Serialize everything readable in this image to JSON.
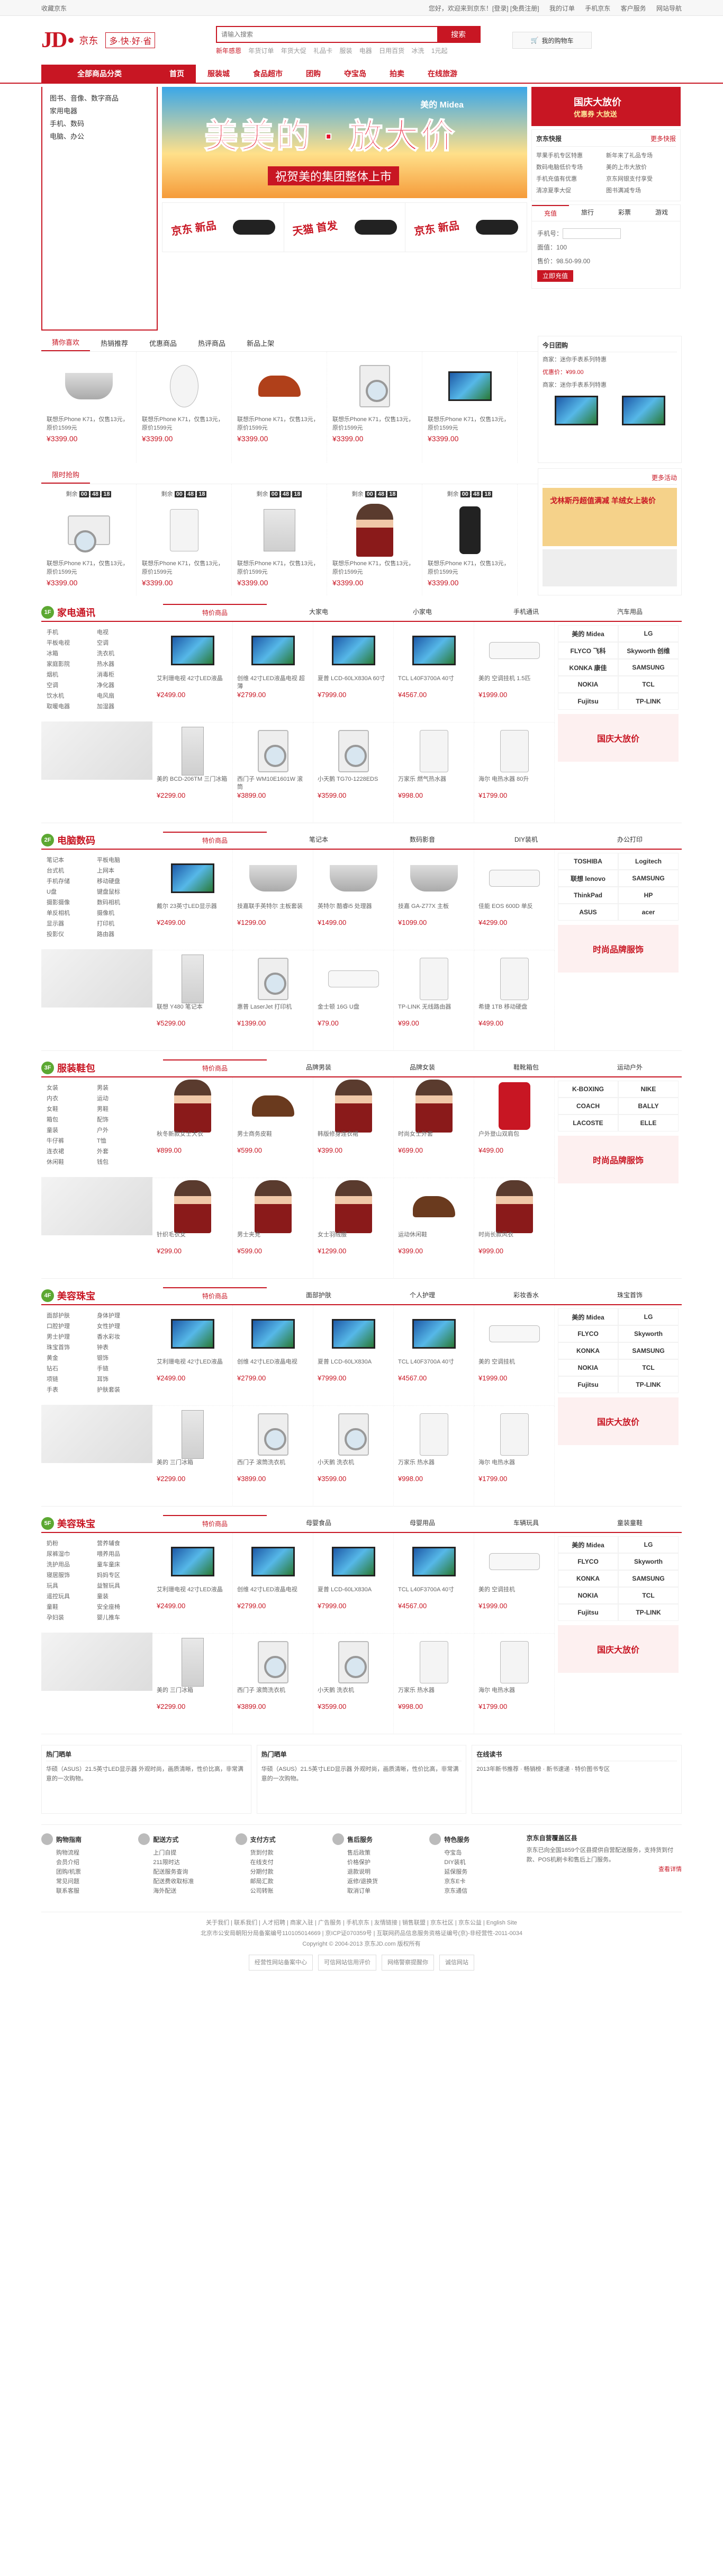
{
  "topbar": {
    "fav": "收藏京东",
    "links": [
      "您好，欢迎来到京东！[登录] [免费注册]",
      "我的订单",
      "手机京东",
      "客户服务",
      "网站导航"
    ]
  },
  "header": {
    "logo_jd": "JD",
    "logo_com": "京东",
    "logo_dotcom": "COM",
    "slogan": "多·快·好·省",
    "search_placeholder": "请输入搜索",
    "search_btn": "搜索",
    "hot": [
      "新年感恩",
      "年货订单",
      "年货大促",
      "礼品卡",
      "服装",
      "电器",
      "日用百货",
      "冰洗",
      "1元起"
    ],
    "cart": "我的购物车"
  },
  "nav": {
    "allcat": "全部商品分类",
    "items": [
      "首页",
      "服装城",
      "食品超市",
      "团购",
      "夺宝岛",
      "拍卖",
      "在线旅游"
    ]
  },
  "catmenu": [
    "图书、音像、数字商品",
    "家用电器",
    "手机、数码",
    "电脑、办公"
  ],
  "banner": {
    "title": "美美的 · 放大价",
    "subtitle": "祝贺美的集团整体上市",
    "brand": "美的 Midea"
  },
  "promo3": [
    "京东 新品",
    "天猫 首发",
    "京东 新品"
  ],
  "rightcol": {
    "banner_title": "国庆大放价",
    "banner_sub": "优惠券 大放送",
    "news_title": "京东快报",
    "news_more": "更多快报",
    "news": [
      "苹果手机专区特惠",
      "新年来了礼品专场",
      "数码电脑低价专场",
      "美的上市大放价",
      "手机充值有优惠",
      "京东网银支付享受",
      "清凉夏季大促",
      "图书满减专场"
    ],
    "tabs": [
      "充值",
      "旅行",
      "彩票",
      "游戏"
    ],
    "recharge_label": "手机号：",
    "recharge_amount": "面值：100",
    "recharge_price": "售价：98.50-99.00",
    "recharge_btn": "立即充值"
  },
  "row1": {
    "tabs": [
      "猜你喜欢",
      "热销推荐",
      "优惠商品",
      "热评商品",
      "新品上架"
    ],
    "products": [
      {
        "name": "联想乐Phone K71，仅售13元，原价1599元",
        "price": "¥3399.00"
      },
      {
        "name": "联想乐Phone K71，仅售13元，原价1599元",
        "price": "¥3399.00"
      },
      {
        "name": "联想乐Phone K71，仅售13元，原价1599元",
        "price": "¥3399.00"
      },
      {
        "name": "联想乐Phone K71，仅售13元，原价1599元",
        "price": "¥3399.00"
      },
      {
        "name": "联想乐Phone K71，仅售13元，原价1599元",
        "price": "¥3399.00"
      }
    ],
    "side_title": "今日团购",
    "side_lines": [
      "商家：迷你手表系列特惠",
      "优惠价：¥99.00",
      "商家：迷你手表系列特惠"
    ]
  },
  "row2": {
    "title": "限时抢购",
    "timer_label": "剩余",
    "timer": [
      "00",
      "48",
      "18"
    ],
    "products": [
      {
        "name": "联想乐Phone K71，仅售13元，原价1599元",
        "price": "¥3399.00"
      },
      {
        "name": "联想乐Phone K71，仅售13元，原价1599元",
        "price": "¥3399.00"
      },
      {
        "name": "联想乐Phone K71，仅售13元，原价1599元",
        "price": "¥3399.00"
      },
      {
        "name": "联想乐Phone K71，仅售13元，原价1599元",
        "price": "¥3399.00"
      },
      {
        "name": "联想乐Phone K71，仅售13元，原价1599元",
        "price": "¥3399.00"
      }
    ],
    "side_more": "更多活动",
    "side_ad": "戈林斯丹超值满减 羊绒女上装价"
  },
  "floors": [
    {
      "num": "1F",
      "title": "家电通讯",
      "tabs": [
        "特价商品",
        "大家电",
        "小家电",
        "手机通讯",
        "汽车用品"
      ],
      "cats": [
        "手机",
        "电视",
        "平板电视",
        "空调",
        "冰箱",
        "洗衣机",
        "家庭影院",
        "热水器",
        "烟机",
        "消毒柜",
        "空调",
        "净化器",
        "饮水机",
        "电风扇",
        "取暖电器",
        "加湿器"
      ],
      "items": [
        {
          "kind": "tv",
          "name": "艾利珊电视 42寸LED液晶",
          "price": "¥2499.00"
        },
        {
          "kind": "tv",
          "name": "创维 42寸LED液晶电视 超薄",
          "price": "¥2799.00"
        },
        {
          "kind": "tv",
          "name": "夏普 LCD-60LX830A 60寸",
          "price": "¥7999.00"
        },
        {
          "kind": "tv",
          "name": "TCL L40F3700A 40寸",
          "price": "¥4567.00"
        },
        {
          "kind": "ac",
          "name": "美的 空调挂机 1.5匹",
          "price": "¥1999.00"
        },
        {
          "kind": "fridge",
          "name": "美的 BCD-206TM 三门冰箱",
          "price": "¥2299.00"
        },
        {
          "kind": "wash",
          "name": "西门子 WM10E1601W 滚筒",
          "price": "¥3899.00"
        },
        {
          "kind": "wash",
          "name": "小天鹅 TG70-1228EDS",
          "price": "¥3599.00"
        },
        {
          "kind": "heater",
          "name": "万家乐 燃气热水器",
          "price": "¥998.00"
        },
        {
          "kind": "heater",
          "name": "海尔 电热水器 80升",
          "price": "¥1799.00"
        }
      ],
      "brands": [
        "美的 Midea",
        "LG",
        "FLYCO 飞科",
        "Skyworth 创维",
        "KONKA 康佳",
        "SAMSUNG",
        "NOKIA",
        "TCL",
        "Fujitsu",
        "TP-LINK"
      ],
      "ad": "国庆大放价"
    },
    {
      "num": "2F",
      "title": "电脑数码",
      "tabs": [
        "特价商品",
        "笔记本",
        "数码影音",
        "DIY装机",
        "办公打印"
      ],
      "cats": [
        "笔记本",
        "平板电脑",
        "台式机",
        "上网本",
        "手机存储",
        "移动硬盘",
        "U盘",
        "键盘鼠标",
        "摄影摄像",
        "数码相机",
        "单反相机",
        "摄像机",
        "显示器",
        "打印机",
        "投影仪",
        "路由器"
      ],
      "items": [
        {
          "kind": "tv",
          "name": "戴尔 23英寸LED显示器",
          "price": "¥2499.00"
        },
        {
          "kind": "pot",
          "name": "技嘉联手英特尔 主板套装",
          "price": "¥1299.00"
        },
        {
          "kind": "pot",
          "name": "英特尔 酷睿i5 处理器",
          "price": "¥1499.00"
        },
        {
          "kind": "pot",
          "name": "技嘉 GA-Z77X 主板",
          "price": "¥1099.00"
        },
        {
          "kind": "ac",
          "name": "佳能 EOS 600D 单反",
          "price": "¥4299.00"
        },
        {
          "kind": "fridge",
          "name": "联想 Y480 笔记本",
          "price": "¥5299.00"
        },
        {
          "kind": "wash",
          "name": "惠普 LaserJet 打印机",
          "price": "¥1399.00"
        },
        {
          "kind": "ac",
          "name": "金士顿 16G U盘",
          "price": "¥79.00"
        },
        {
          "kind": "heater",
          "name": "TP-LINK 无线路由器",
          "price": "¥99.00"
        },
        {
          "kind": "heater",
          "name": "希捷 1TB 移动硬盘",
          "price": "¥499.00"
        }
      ],
      "brands": [
        "TOSHIBA",
        "Logitech",
        "联想 lenovo",
        "SAMSUNG",
        "ThinkPad",
        "HP",
        "ASUS",
        "acer"
      ],
      "ad": "时尚品牌服饰"
    },
    {
      "num": "3F",
      "title": "服装鞋包",
      "tabs": [
        "特价商品",
        "品牌男装",
        "品牌女装",
        "鞋靴箱包",
        "运动户外"
      ],
      "cats": [
        "女装",
        "男装",
        "内衣",
        "运动",
        "女鞋",
        "男鞋",
        "箱包",
        "配饰",
        "童装",
        "户外",
        "牛仔裤",
        "T恤",
        "连衣裙",
        "外套",
        "休闲鞋",
        "钱包"
      ],
      "items": [
        {
          "kind": "person",
          "name": "秋冬新款女士大衣",
          "price": "¥899.00"
        },
        {
          "kind": "shoe",
          "name": "男士商务皮鞋",
          "price": "¥599.00"
        },
        {
          "kind": "person",
          "name": "韩版修身连衣裙",
          "price": "¥399.00"
        },
        {
          "kind": "person",
          "name": "时尚女士外套",
          "price": "¥699.00"
        },
        {
          "kind": "bag",
          "name": "户外登山双肩包",
          "price": "¥499.00"
        },
        {
          "kind": "person",
          "name": "针织毛衣女",
          "price": "¥299.00"
        },
        {
          "kind": "person",
          "name": "男士夹克",
          "price": "¥599.00"
        },
        {
          "kind": "person",
          "name": "女士羽绒服",
          "price": "¥1299.00"
        },
        {
          "kind": "shoe",
          "name": "运动休闲鞋",
          "price": "¥399.00"
        },
        {
          "kind": "person",
          "name": "时尚长款风衣",
          "price": "¥999.00"
        }
      ],
      "brands": [
        "K-BOXING",
        "NIKE",
        "COACH",
        "BALLY",
        "LACOSTE",
        "ELLE"
      ],
      "ad": "时尚品牌服饰"
    },
    {
      "num": "4F",
      "title": "美容珠宝",
      "tabs": [
        "特价商品",
        "面部护肤",
        "个人护理",
        "彩妆香水",
        "珠宝首饰"
      ],
      "cats": [
        "面部护肤",
        "身体护理",
        "口腔护理",
        "女性护理",
        "男士护理",
        "香水彩妆",
        "珠宝首饰",
        "钟表",
        "黄金",
        "银饰",
        "钻石",
        "手链",
        "项链",
        "耳饰",
        "手表",
        "护肤套装"
      ],
      "items": [
        {
          "kind": "tv",
          "name": "艾利珊电视 42寸LED液晶",
          "price": "¥2499.00"
        },
        {
          "kind": "tv",
          "name": "创维 42寸LED液晶电视",
          "price": "¥2799.00"
        },
        {
          "kind": "tv",
          "name": "夏普 LCD-60LX830A",
          "price": "¥7999.00"
        },
        {
          "kind": "tv",
          "name": "TCL L40F3700A 40寸",
          "price": "¥4567.00"
        },
        {
          "kind": "ac",
          "name": "美的 空调挂机",
          "price": "¥1999.00"
        },
        {
          "kind": "fridge",
          "name": "美的 三门冰箱",
          "price": "¥2299.00"
        },
        {
          "kind": "wash",
          "name": "西门子 滚筒洗衣机",
          "price": "¥3899.00"
        },
        {
          "kind": "wash",
          "name": "小天鹅 洗衣机",
          "price": "¥3599.00"
        },
        {
          "kind": "heater",
          "name": "万家乐 热水器",
          "price": "¥998.00"
        },
        {
          "kind": "heater",
          "name": "海尔 电热水器",
          "price": "¥1799.00"
        }
      ],
      "brands": [
        "美的 Midea",
        "LG",
        "FLYCO",
        "Skyworth",
        "KONKA",
        "SAMSUNG",
        "NOKIA",
        "TCL",
        "Fujitsu",
        "TP-LINK"
      ],
      "ad": "国庆大放价"
    },
    {
      "num": "5F",
      "title": "美容珠宝",
      "tabs": [
        "特价商品",
        "母婴食品",
        "母婴用品",
        "车辆玩具",
        "童装童鞋"
      ],
      "cats": [
        "奶粉",
        "营养辅食",
        "尿裤湿巾",
        "喂养用品",
        "洗护用品",
        "童车童床",
        "寝居服饰",
        "妈妈专区",
        "玩具",
        "益智玩具",
        "遥控玩具",
        "童装",
        "童鞋",
        "安全座椅",
        "孕妇装",
        "婴儿推车"
      ],
      "items": [
        {
          "kind": "tv",
          "name": "艾利珊电视 42寸LED液晶",
          "price": "¥2499.00"
        },
        {
          "kind": "tv",
          "name": "创维 42寸LED液晶电视",
          "price": "¥2799.00"
        },
        {
          "kind": "tv",
          "name": "夏普 LCD-60LX830A",
          "price": "¥7999.00"
        },
        {
          "kind": "tv",
          "name": "TCL L40F3700A 40寸",
          "price": "¥4567.00"
        },
        {
          "kind": "ac",
          "name": "美的 空调挂机",
          "price": "¥1999.00"
        },
        {
          "kind": "fridge",
          "name": "美的 三门冰箱",
          "price": "¥2299.00"
        },
        {
          "kind": "wash",
          "name": "西门子 滚筒洗衣机",
          "price": "¥3899.00"
        },
        {
          "kind": "wash",
          "name": "小天鹅 洗衣机",
          "price": "¥3599.00"
        },
        {
          "kind": "heater",
          "name": "万家乐 热水器",
          "price": "¥998.00"
        },
        {
          "kind": "heater",
          "name": "海尔 电热水器",
          "price": "¥1799.00"
        }
      ],
      "brands": [
        "美的 Midea",
        "LG",
        "FLYCO",
        "Skyworth",
        "KONKA",
        "SAMSUNG",
        "NOKIA",
        "TCL",
        "Fujitsu",
        "TP-LINK"
      ],
      "ad": "国庆大放价"
    }
  ],
  "bottom": {
    "panels": [
      {
        "title": "热门晒单",
        "text": "华硕（ASUS）21.5英寸LED显示器 外观时尚，画质清晰，性价比高，非常满意的一次购物。"
      },
      {
        "title": "热门晒单",
        "text": "华硕（ASUS）21.5英寸LED显示器 外观时尚，画质清晰，性价比高，非常满意的一次购物。"
      },
      {
        "title": "在线读书",
        "text": "2013年新书推荐 · 畅销榜 · 新书速递 · 特价图书专区"
      }
    ]
  },
  "help": [
    {
      "title": "购物指南",
      "lines": [
        "购物流程",
        "会员介绍",
        "团购/机票",
        "常见问题",
        "联系客服"
      ]
    },
    {
      "title": "配送方式",
      "lines": [
        "上门自提",
        "211限时达",
        "配送服务查询",
        "配送费收取标准",
        "海外配送"
      ]
    },
    {
      "title": "支付方式",
      "lines": [
        "货到付款",
        "在线支付",
        "分期付款",
        "邮局汇款",
        "公司转账"
      ]
    },
    {
      "title": "售后服务",
      "lines": [
        "售后政策",
        "价格保护",
        "退款说明",
        "返修/退换货",
        "取消订单"
      ]
    },
    {
      "title": "特色服务",
      "lines": [
        "夺宝岛",
        "DIY装机",
        "延保服务",
        "京东E卡",
        "京东通信"
      ]
    },
    {
      "title": "京东自营覆盖区县",
      "lines": [
        "京东已向全国1859个区县提供自营配送服务，支持货到付款、POS机刷卡和售后上门服务。",
        "查看详情"
      ]
    }
  ],
  "footer": {
    "links": "关于我们 | 联系我们 | 人才招聘 | 商家入驻 | 广告服务 | 手机京东 | 友情链接 | 销售联盟 | 京东社区 | 京东公益 | English Site",
    "copy1": "北京市公安局朝阳分局备案编号110105014669 | 京ICP证070359号 | 互联网药品信息服务资格证编号(京)-非经营性-2011-0034",
    "copy2": "Copyright © 2004-2013 京东JD.com 版权所有",
    "badges": [
      "经营性网站备案中心",
      "可信网站信用评价",
      "网络警察提醒你",
      "诚信网站"
    ]
  }
}
